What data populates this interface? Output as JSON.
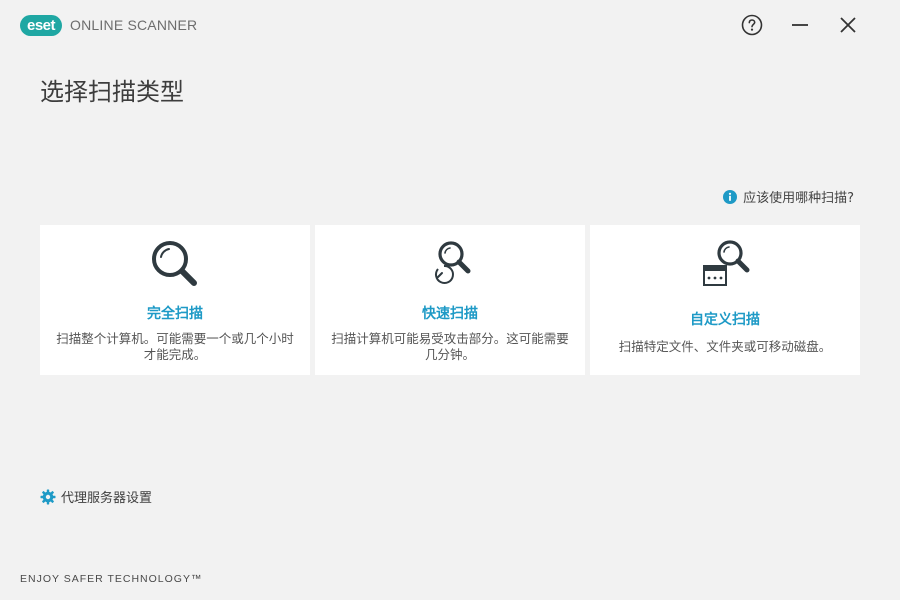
{
  "header": {
    "logo_badge": "eset",
    "logo_text": "ONLINE SCANNER"
  },
  "page": {
    "title": "选择扫描类型",
    "which_scan_link": "应该使用哪种扫描?"
  },
  "cards": [
    {
      "title": "完全扫描",
      "desc": "扫描整个计算机。可能需要一个或几个小时才能完成。",
      "icon": "magnifier-icon"
    },
    {
      "title": "快速扫描",
      "desc": "扫描计算机可能易受攻击部分。这可能需要几分钟。",
      "icon": "quick-scan-icon"
    },
    {
      "title": "自定义扫描",
      "desc": "扫描特定文件、文件夹或可移动磁盘。",
      "icon": "custom-scan-icon"
    }
  ],
  "footer": {
    "proxy_link": "代理服务器设置",
    "slogan": "ENJOY SAFER TECHNOLOGY™"
  },
  "colors": {
    "brand": "#1fa7a3",
    "link": "#1e9ac6",
    "icon_dark": "#2f3a40"
  }
}
